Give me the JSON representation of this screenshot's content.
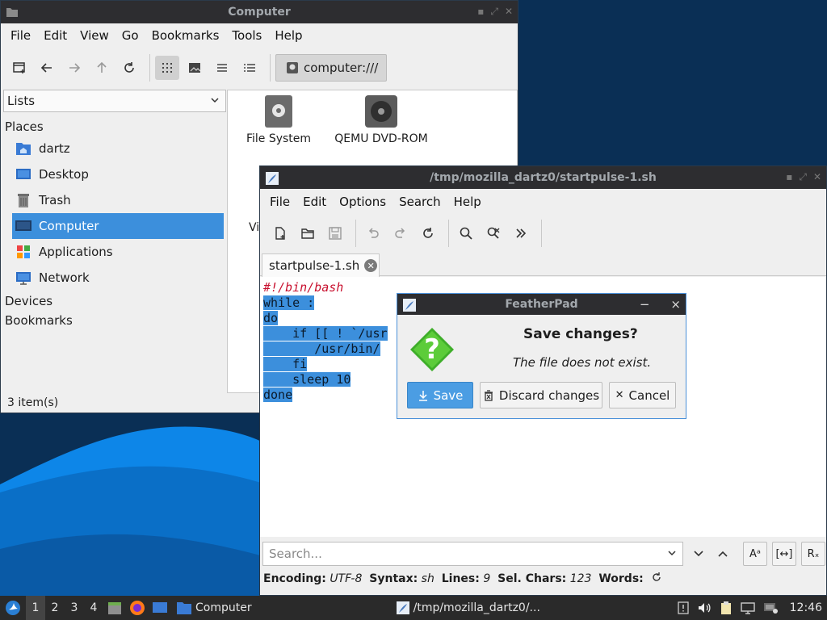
{
  "file_manager": {
    "title": "Computer",
    "menu": [
      "File",
      "Edit",
      "View",
      "Go",
      "Bookmarks",
      "Tools",
      "Help"
    ],
    "location": "computer:///",
    "side_pane_mode": "Lists",
    "sections": {
      "places": "Places",
      "devices": "Devices",
      "bookmarks": "Bookmarks"
    },
    "places": [
      {
        "label": "dartz",
        "icon": "home-folder-icon",
        "selected": false
      },
      {
        "label": "Desktop",
        "icon": "desktop-icon",
        "selected": false
      },
      {
        "label": "Trash",
        "icon": "trash-icon",
        "selected": false
      },
      {
        "label": "Computer",
        "icon": "computer-icon",
        "selected": true
      },
      {
        "label": "Applications",
        "icon": "applications-icon",
        "selected": false
      },
      {
        "label": "Network",
        "icon": "network-icon",
        "selected": false
      }
    ],
    "items": [
      {
        "label": "File System",
        "icon": "drive-icon"
      },
      {
        "label": "QEMU DVD-ROM",
        "icon": "optical-drive-icon"
      },
      {
        "label": "Vi",
        "icon": "volume-icon"
      }
    ],
    "status": "3 item(s)"
  },
  "editor": {
    "title": "/tmp/mozilla_dartz0/startpulse-1.sh",
    "menu": [
      "File",
      "Edit",
      "Options",
      "Search",
      "Help"
    ],
    "tab": "startpulse-1.sh",
    "lines": [
      "#!/bin/bash",
      "while :",
      "do",
      "    if [[ ! `/usr",
      "       /usr/bin/",
      "    fi",
      "    sleep 10",
      "done"
    ],
    "search_placeholder": "Search...",
    "status": {
      "encoding_label": "Encoding:",
      "encoding": "UTF-8",
      "syntax_label": "Syntax:",
      "syntax": "sh",
      "lines_label": "Lines:",
      "lines": "9",
      "selchars_label": "Sel. Chars:",
      "selchars": "123",
      "words_label": "Words:"
    }
  },
  "dialog": {
    "title": "FeatherPad",
    "heading": "Save changes?",
    "message": "The file does not exist.",
    "buttons": {
      "save": "Save",
      "discard": "Discard changes",
      "cancel": "Cancel"
    },
    "minimize_glyph": "−",
    "close_glyph": "×"
  },
  "taskbar": {
    "workspaces": [
      "1",
      "2",
      "3",
      "4"
    ],
    "active_workspace": "1",
    "tasks": [
      {
        "label": "Computer",
        "icon": "folder-icon"
      },
      {
        "label": "/tmp/mozilla_dartz0/...",
        "icon": "featherpad-icon"
      }
    ],
    "clock": "12:46"
  },
  "colors": {
    "accent": "#3c8fdc",
    "titlebar": "#2d2d30",
    "desktop": "#0a2f55",
    "panel": "#2a2a2a"
  }
}
